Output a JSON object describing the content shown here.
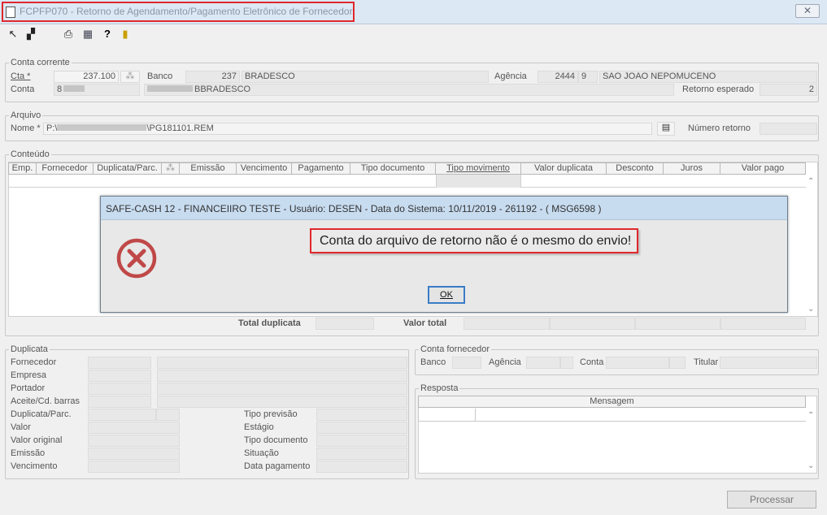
{
  "window": {
    "title": "FCPFP070 - Retorno de Agendamento/Pagamento Eletrônico de Fornecedor",
    "close": "✕"
  },
  "toolbar": {
    "icons": [
      "return-icon",
      "copy-icon",
      "print-icon",
      "grid-icon",
      "help-icon",
      "exit-icon"
    ]
  },
  "conta_corrente": {
    "legend": "Conta corrente",
    "cta_label": "Cta *",
    "cta_value": "237.100",
    "banco_label": "Banco",
    "banco_code": "237",
    "banco_name": "BRADESCO",
    "agencia_label": "Agência",
    "agencia_code": "2444",
    "agencia_digit": "9",
    "agencia_name": "SAO JOAO NEPOMUCENO",
    "conta_label": "Conta",
    "conta_value": "8",
    "conta_desc": "BBRADESCO",
    "retorno_label": "Retorno esperado",
    "retorno_value": "2"
  },
  "arquivo": {
    "legend": "Arquivo",
    "nome_label": "Nome *",
    "nome_prefix": "P:\\",
    "nome_suffix": "\\PG181101.REM",
    "numero_label": "Número retorno",
    "numero_value": ""
  },
  "conteudo": {
    "legend": "Conteúdo",
    "columns": [
      "Emp.",
      "Fornecedor",
      "Duplicata/Parc.",
      "",
      "Emissão",
      "Vencimento",
      "Pagamento",
      "Tipo documento",
      "Tipo movimento",
      "Valor duplicata",
      "Desconto",
      "Juros",
      "Valor pago"
    ],
    "total_duplicata_label": "Total duplicata",
    "valor_total_label": "Valor total"
  },
  "dialog": {
    "title": "SAFE-CASH 12 - FINANCEIIRO TESTE - Usuário: DESEN - Data do Sistema: 10/11/2019 - 261192 - ( MSG6598 )",
    "message": "Conta do arquivo de retorno não é o mesmo do envio!",
    "ok": "OK"
  },
  "duplicata": {
    "legend": "Duplicata",
    "fornecedor": "Fornecedor",
    "empresa": "Empresa",
    "portador": "Portador",
    "aceite": "Aceite/Cd. barras",
    "duplicata_parc": "Duplicata/Parc.",
    "valor": "Valor",
    "valor_original": "Valor original",
    "emissao": "Emissão",
    "vencimento": "Vencimento",
    "tipo_previsao": "Tipo previsão",
    "estagio": "Estágio",
    "tipo_documento": "Tipo documento",
    "situacao": "Situação",
    "data_pagamento": "Data pagamento"
  },
  "conta_fornecedor": {
    "legend": "Conta fornecedor",
    "banco": "Banco",
    "agencia": "Agência",
    "conta": "Conta",
    "titular": "Titular"
  },
  "resposta": {
    "legend": "Resposta",
    "mensagem_header": "Mensagem"
  },
  "actions": {
    "processar": "Processar"
  }
}
